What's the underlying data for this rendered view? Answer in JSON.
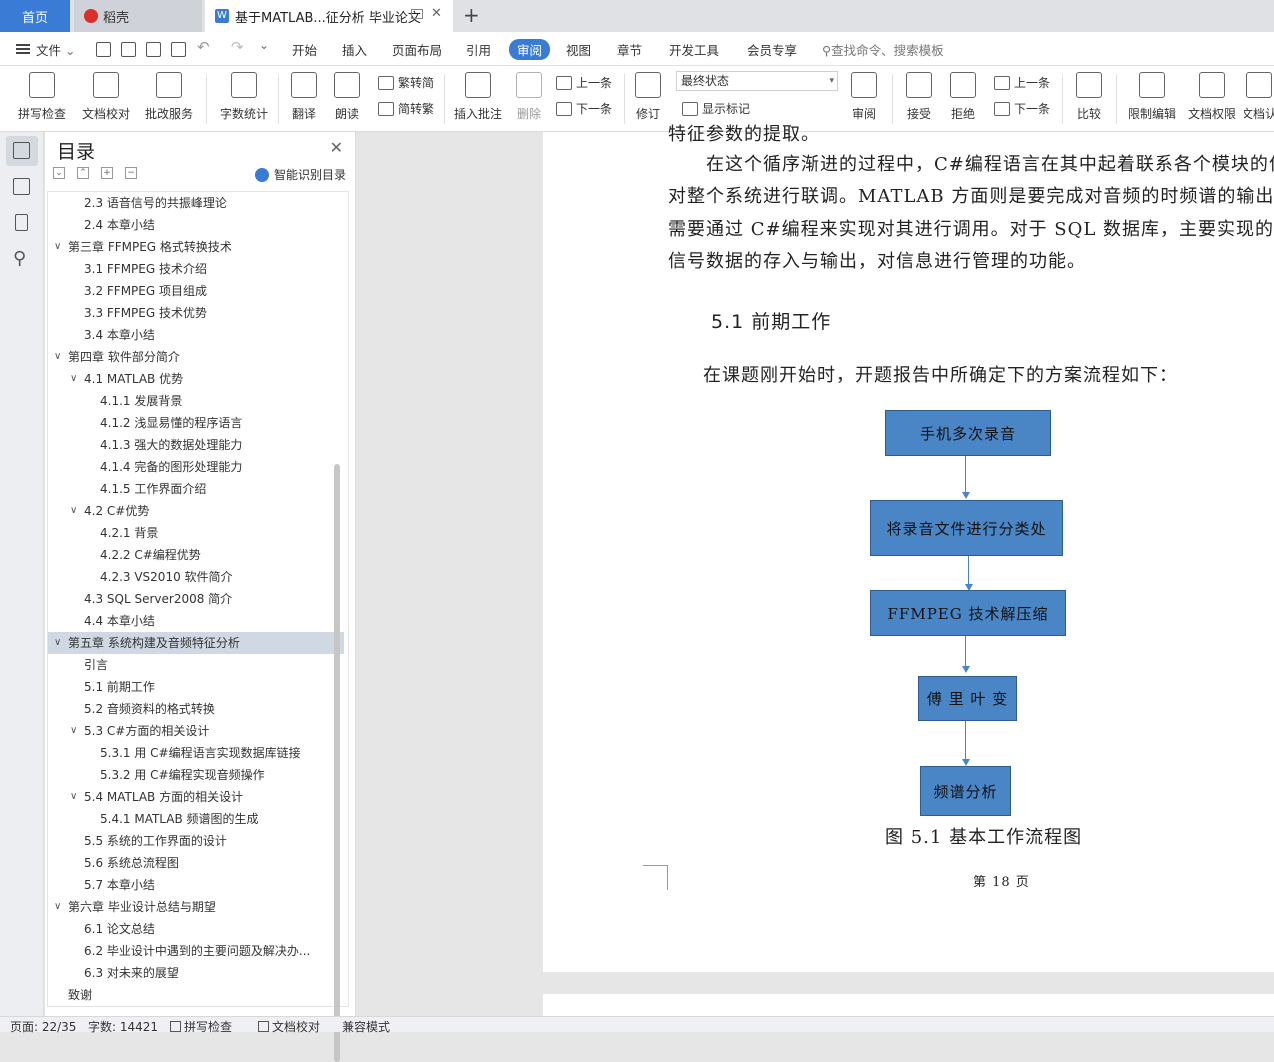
{
  "tabs": {
    "home": "首页",
    "daoke": "稻壳",
    "doc": "基于MATLAB...征分析 毕业论文",
    "new_tab": "+"
  },
  "menu": {
    "file": "文件",
    "items": [
      "开始",
      "插入",
      "页面布局",
      "引用",
      "审阅",
      "视图",
      "章节",
      "开发工具",
      "会员专享"
    ],
    "search": "查找命令、搜索模板"
  },
  "ribbon": {
    "spell": "拼写检查",
    "proof": "文档校对",
    "annotate_service": "批改服务",
    "word_count": "字数统计",
    "translate": "翻译",
    "read_aloud": "朗读",
    "trad": "繁转简",
    "simp": "简转繁",
    "insert_comment": "插入批注",
    "delete": "删除",
    "prev_comment": "上一条",
    "next_comment": "下一条",
    "revise": "修订",
    "final_state": "最终状态",
    "show_markup": "显示标记",
    "review": "审阅",
    "accept": "接受",
    "reject": "拒绝",
    "prev_change": "上一条",
    "next_change": "下一条",
    "compare": "比较",
    "restrict": "限制编辑",
    "permission": "文档权限",
    "doc_more": "文档认"
  },
  "toc": {
    "title": "目录",
    "smart": "智能识别目录",
    "items": [
      {
        "text": "2.3 语音信号的共振峰理论",
        "level": 2
      },
      {
        "text": "2.4 本章小结",
        "level": 2
      },
      {
        "text": "第三章 FFMPEG 格式转换技术",
        "level": 1,
        "expanded": true
      },
      {
        "text": "3.1 FFMPEG 技术介绍",
        "level": 2
      },
      {
        "text": "3.2 FFMPEG 项目组成",
        "level": 2
      },
      {
        "text": "3.3 FFMPEG 技术优势",
        "level": 2
      },
      {
        "text": "3.4 本章小结",
        "level": 2
      },
      {
        "text": "第四章 软件部分简介",
        "level": 1,
        "expanded": true
      },
      {
        "text": "4.1 MATLAB 优势",
        "level": 2,
        "expanded": true
      },
      {
        "text": "4.1.1 发展背景",
        "level": 3
      },
      {
        "text": "4.1.2 浅显易懂的程序语言",
        "level": 3
      },
      {
        "text": "4.1.3 强大的数据处理能力",
        "level": 3
      },
      {
        "text": "4.1.4 完备的图形处理能力",
        "level": 3
      },
      {
        "text": "4.1.5 工作界面介绍",
        "level": 3
      },
      {
        "text": "4.2 C#优势",
        "level": 2,
        "expanded": true
      },
      {
        "text": "4.2.1 背景",
        "level": 3
      },
      {
        "text": "4.2.2 C#编程优势",
        "level": 3
      },
      {
        "text": "4.2.3 VS2010 软件简介",
        "level": 3
      },
      {
        "text": "4.3 SQL Server2008 简介",
        "level": 2
      },
      {
        "text": "4.4 本章小结",
        "level": 2
      },
      {
        "text": "第五章 系统构建及音频特征分析",
        "level": 1,
        "expanded": true,
        "selected": true
      },
      {
        "text": "引言",
        "level": 2
      },
      {
        "text": "5.1 前期工作",
        "level": 2
      },
      {
        "text": "5.2 音频资料的格式转换",
        "level": 2
      },
      {
        "text": "5.3 C#方面的相关设计",
        "level": 2,
        "expanded": true
      },
      {
        "text": "5.3.1 用 C#编程语言实现数据库链接",
        "level": 3
      },
      {
        "text": "5.3.2 用 C#编程实现音频操作",
        "level": 3
      },
      {
        "text": "5.4 MATLAB 方面的相关设计",
        "level": 2,
        "expanded": true
      },
      {
        "text": "5.4.1 MATLAB 频谱图的生成",
        "level": 3
      },
      {
        "text": "5.5 系统的工作界面的设计",
        "level": 2
      },
      {
        "text": "5.6 系统总流程图",
        "level": 2
      },
      {
        "text": "5.7 本章小结",
        "level": 2
      },
      {
        "text": "第六章 毕业设计总结与期望",
        "level": 1,
        "expanded": true
      },
      {
        "text": "6.1 论文总结",
        "level": 2
      },
      {
        "text": "6.2 毕业设计中遇到的主要问题及解决办...",
        "level": 2
      },
      {
        "text": "6.3 对未来的展望",
        "level": 2
      },
      {
        "text": "致谢",
        "level": 1
      }
    ]
  },
  "document": {
    "top_cut": "特征参数的提取。",
    "para_lines": [
      "在这个循序渐进的过程中，C#编程语言在其中起着联系各个模块的作",
      "对整个系统进行联调。MATLAB 方面则是要完成对音频的时频谱的输出分",
      "需要通过 C#编程来实现对其进行调用。对于 SQL 数据库，主要实现的是",
      "信号数据的存入与输出，对信息进行管理的功能。"
    ],
    "heading": "5.1  前期工作",
    "intro": "在课题刚开始时，开题报告中所确定下的方案流程如下：",
    "flow_steps": [
      "手机多次录音",
      "将录音文件进行分类处",
      "FFMPEG 技术解压缩",
      "傅 里 叶 变",
      "频谱分析"
    ],
    "figure_caption": "图 5.1  基本工作流程图",
    "page_footer": "第  18  页"
  },
  "status": {
    "page": "页面: 22/35",
    "words": "字数: 14421",
    "spell": "拼写检查",
    "proof": "文档校对",
    "compat": "兼容模式"
  },
  "colors": {
    "accent": "#3a7bd5",
    "flow_fill": "#4a86c5",
    "toc_selected": "#cfd8e3"
  }
}
